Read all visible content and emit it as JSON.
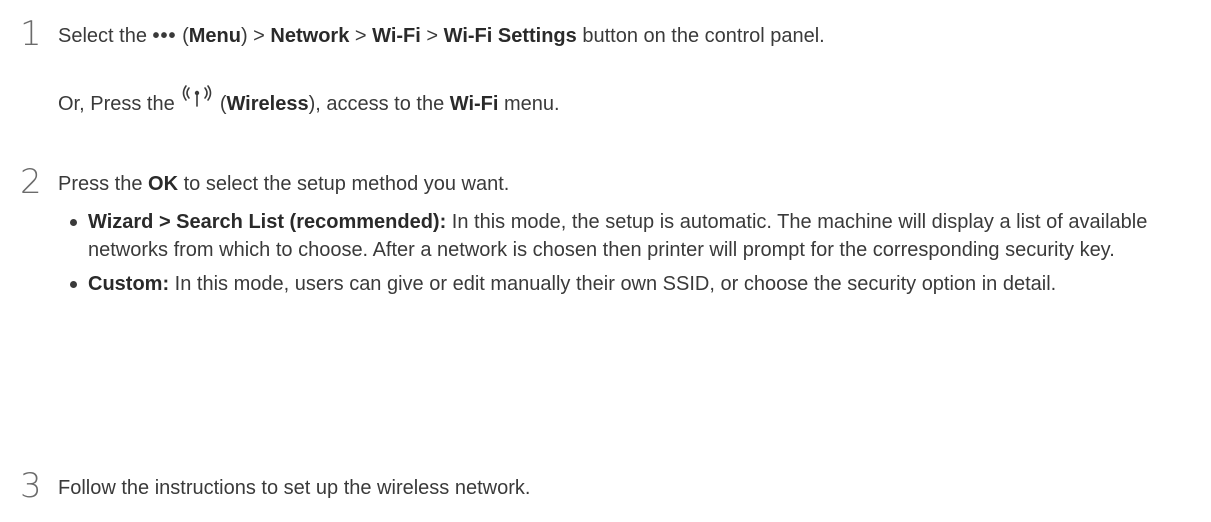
{
  "steps": [
    {
      "number": "1",
      "line1": {
        "t1": "Select the ",
        "menu_dots": "•••",
        "t2": " (",
        "menu": "Menu",
        "t3": ") > ",
        "network": "Network",
        "t4": " > ",
        "wifi": "Wi-Fi",
        "t5": " > ",
        "wifi_settings": "Wi-Fi Settings",
        "t6": " button on the control panel."
      },
      "line2": {
        "t1": "Or, Press the ",
        "wireless_icon": "wireless-icon",
        "t2": " (",
        "wireless": "Wireless",
        "t3": "), access to the ",
        "wifi": "Wi-Fi",
        "t4": " menu."
      }
    },
    {
      "number": "2",
      "line1": {
        "t1": "Press the ",
        "ok": "OK",
        "t2": " to select the setup method you want."
      },
      "bullets": [
        {
          "label": "Wizard > Search List (recommended):",
          "text": " In this mode, the setup is automatic. The machine will display a list of available networks from which to choose. After a network is chosen then printer will prompt for the corresponding security key."
        },
        {
          "label": "Custom:",
          "text": " In this mode, users can give or edit manually their own SSID, or choose the security option in detail."
        }
      ]
    },
    {
      "number": "3",
      "line1": {
        "t1": "Follow the instructions to set up the wireless network."
      }
    }
  ]
}
